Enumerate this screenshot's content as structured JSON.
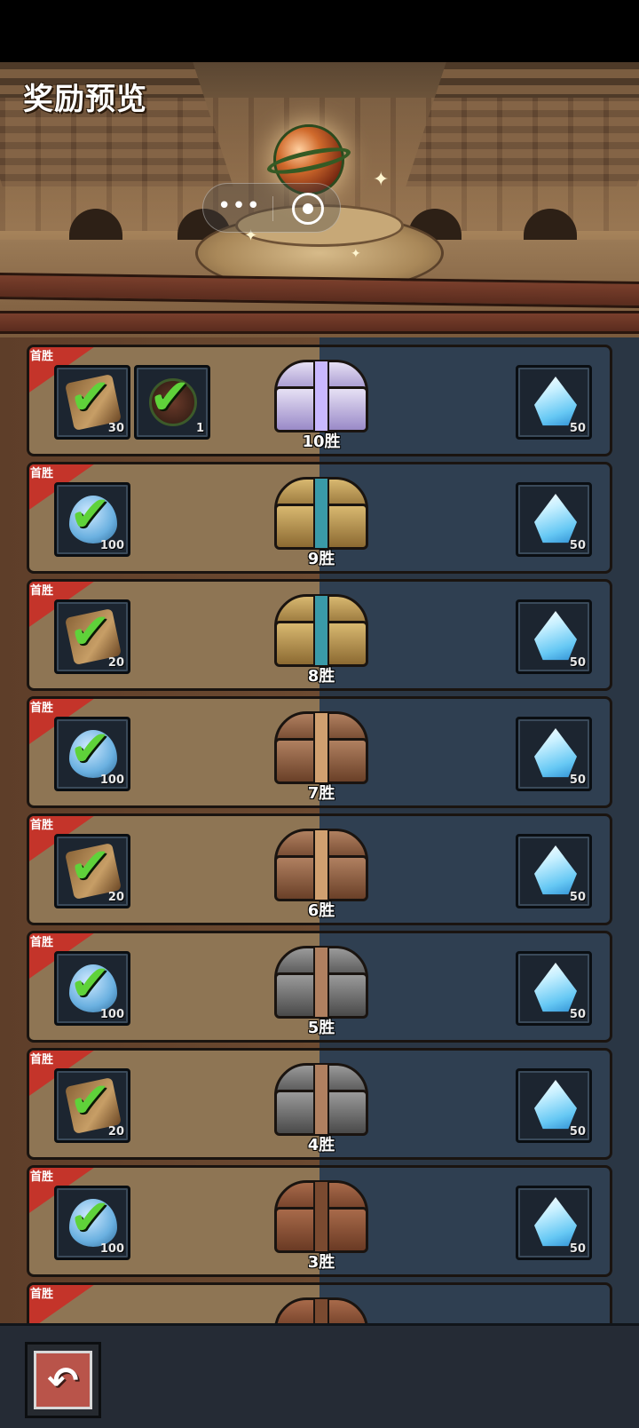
{
  "page": {
    "title": "奖励预览"
  },
  "capsule": {
    "more_glyph": "•••",
    "close_glyph": ""
  },
  "colors": {
    "ribbon": "#c4342a",
    "panel_left": "#8e7554",
    "panel_right": "#2f3f51",
    "check": "#5fd23a"
  },
  "rows": [
    {
      "ribbon": "首胜",
      "chest": "crystal",
      "wins": "10胜",
      "first_rewards": [
        {
          "icon": "scroll-icon",
          "qty": "30"
        },
        {
          "icon": "seed-icon",
          "qty": "1"
        }
      ],
      "reward": {
        "icon": "crystal-gem-icon",
        "qty": "50"
      }
    },
    {
      "ribbon": "首胜",
      "chest": "gold",
      "wins": "9胜",
      "first_rewards": [
        {
          "icon": "water-drop-icon",
          "qty": "100"
        }
      ],
      "reward": {
        "icon": "crystal-gem-icon",
        "qty": "50"
      }
    },
    {
      "ribbon": "首胜",
      "chest": "gold",
      "wins": "8胜",
      "first_rewards": [
        {
          "icon": "scroll-icon",
          "qty": "20"
        }
      ],
      "reward": {
        "icon": "crystal-gem-icon",
        "qty": "50"
      }
    },
    {
      "ribbon": "首胜",
      "chest": "bronze",
      "wins": "7胜",
      "first_rewards": [
        {
          "icon": "water-drop-icon",
          "qty": "100"
        }
      ],
      "reward": {
        "icon": "crystal-gem-icon",
        "qty": "50"
      }
    },
    {
      "ribbon": "首胜",
      "chest": "bronze",
      "wins": "6胜",
      "first_rewards": [
        {
          "icon": "scroll-icon",
          "qty": "20"
        }
      ],
      "reward": {
        "icon": "crystal-gem-icon",
        "qty": "50"
      }
    },
    {
      "ribbon": "首胜",
      "chest": "iron",
      "wins": "5胜",
      "first_rewards": [
        {
          "icon": "water-drop-icon",
          "qty": "100"
        }
      ],
      "reward": {
        "icon": "crystal-gem-icon",
        "qty": "50"
      }
    },
    {
      "ribbon": "首胜",
      "chest": "iron",
      "wins": "4胜",
      "first_rewards": [
        {
          "icon": "scroll-icon",
          "qty": "20"
        }
      ],
      "reward": {
        "icon": "crystal-gem-icon",
        "qty": "50"
      }
    },
    {
      "ribbon": "首胜",
      "chest": "wood",
      "wins": "3胜",
      "first_rewards": [
        {
          "icon": "water-drop-icon",
          "qty": "100"
        }
      ],
      "reward": {
        "icon": "crystal-gem-icon",
        "qty": "50"
      }
    },
    {
      "ribbon": "首胜",
      "chest": "wood",
      "wins": "",
      "first_rewards": [],
      "reward": null
    }
  ],
  "bottom_bar": {
    "back_icon": "back-arrow-icon",
    "back_glyph": "↶"
  }
}
